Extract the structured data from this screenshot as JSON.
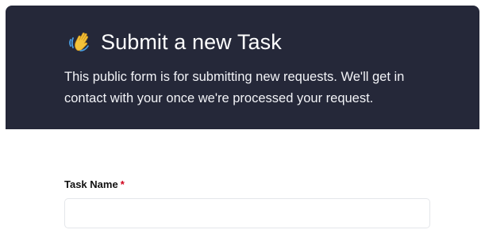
{
  "header": {
    "title": "Submit a new Task",
    "icon": "waving-hand-icon",
    "subtitle": "This public form is for submitting new requests. We'll get in contact with your once we're processed your request.",
    "background_color": "#252839"
  },
  "form": {
    "fields": [
      {
        "label": "Task Name",
        "required_marker": "*",
        "value": "",
        "placeholder": ""
      }
    ]
  }
}
